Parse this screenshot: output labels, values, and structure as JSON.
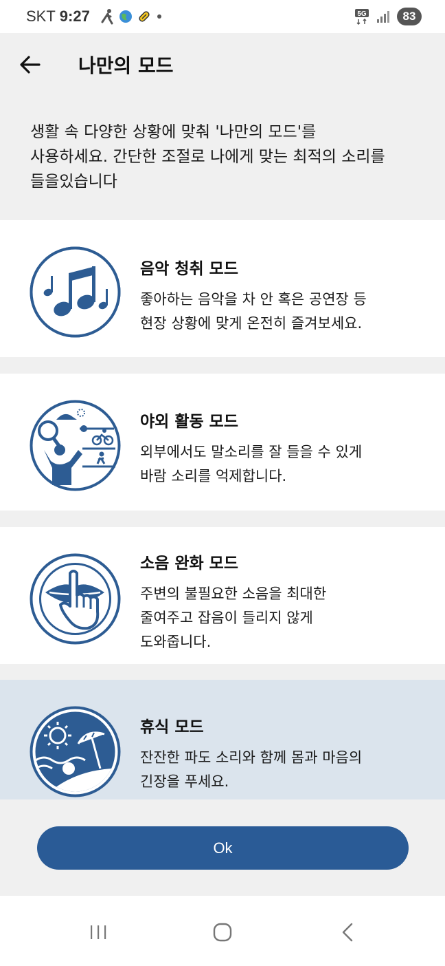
{
  "status_bar": {
    "carrier": "SKT",
    "time": "9:27",
    "network": "5G",
    "battery": "83"
  },
  "header": {
    "title": "나만의 모드"
  },
  "intro": {
    "line1": "생활 속 다양한 상황에 맞춰 '나만의 모드'를",
    "line2": "사용하세요. 간단한 조절로 나에게 맞는 최적의 소리를",
    "line3": "들을있습니다"
  },
  "modes": [
    {
      "title": "음악 청취 모드",
      "desc": [
        "좋아하는 음악을 차 안 혹은 공연장 등",
        "현장 상황에 맞게 온전히 즐겨보세요."
      ],
      "icon": "music-notes-icon"
    },
    {
      "title": "야외 활동 모드",
      "desc": [
        "외부에서도 말소리를 잘 들을 수 있게",
        "바람 소리를 억제합니다."
      ],
      "icon": "outdoor-activity-icon"
    },
    {
      "title": "소음 완화 모드",
      "desc": [
        "주변의 불필요한 소음을 최대한",
        "줄여주고 잡음이 들리지 않게",
        "도와줍니다."
      ],
      "icon": "quiet-gesture-icon"
    },
    {
      "title": "휴식 모드",
      "desc": [
        "잔잔한 파도 소리와 함께 몸과 마음의",
        "긴장을 푸세요."
      ],
      "icon": "beach-rest-icon",
      "selected": true
    }
  ],
  "ok_button": {
    "label": "Ok"
  },
  "colors": {
    "accent": "#2a5b96",
    "icon_blue": "#2d5c93",
    "selected_bg": "#dbe4ed",
    "page_bg": "#f0f0f0"
  }
}
